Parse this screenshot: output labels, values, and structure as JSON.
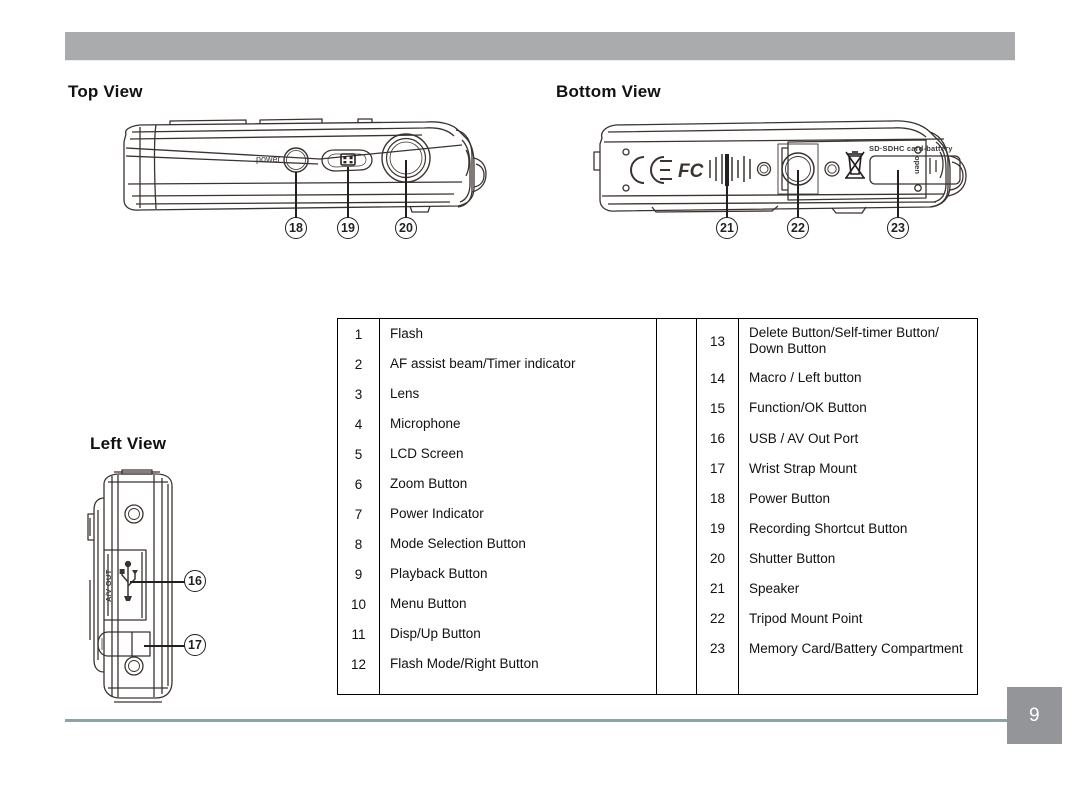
{
  "page": {
    "number": "9",
    "header_color": "#a9abad",
    "footer_rule_color": "#8fa3a4",
    "badge_color": "#939598"
  },
  "views": {
    "top": {
      "title": "Top View",
      "labels": {
        "power": "power"
      },
      "callouts": [
        {
          "id": "18",
          "label": "18"
        },
        {
          "id": "19",
          "label": "19"
        },
        {
          "id": "20",
          "label": "20"
        }
      ]
    },
    "bottom": {
      "title": "Bottom View",
      "labels": {
        "card_battery": "SD·SDHC card-battery",
        "open": "open",
        "ce": "CE",
        "fcc": "FC"
      },
      "callouts": [
        {
          "id": "21",
          "label": "21"
        },
        {
          "id": "22",
          "label": "22"
        },
        {
          "id": "23",
          "label": "23"
        }
      ]
    },
    "left": {
      "title": "Left View",
      "labels": {
        "av_out": "A/V OUT"
      },
      "callouts": [
        {
          "id": "16",
          "label": "16"
        },
        {
          "id": "17",
          "label": "17"
        }
      ]
    }
  },
  "legend": {
    "left_column": [
      {
        "num": "1",
        "text": "Flash"
      },
      {
        "num": "2",
        "text": "AF assist beam/Timer indicator"
      },
      {
        "num": "3",
        "text": "Lens"
      },
      {
        "num": "4",
        "text": "Microphone"
      },
      {
        "num": "5",
        "text": "LCD Screen"
      },
      {
        "num": "6",
        "text": "Zoom Button"
      },
      {
        "num": "7",
        "text": "Power Indicator"
      },
      {
        "num": "8",
        "text": "Mode Selection Button"
      },
      {
        "num": "9",
        "text": "Playback Button"
      },
      {
        "num": "10",
        "text": "Menu Button"
      },
      {
        "num": "11",
        "text": "Disp/Up Button"
      },
      {
        "num": "12",
        "text": "Flash Mode/Right Button"
      }
    ],
    "right_column": [
      {
        "num": "13",
        "text": "Delete Button/Self-timer Button/ Down Button"
      },
      {
        "num": "14",
        "text": "Macro / Left button"
      },
      {
        "num": "15",
        "text": "Function/OK Button"
      },
      {
        "num": "16",
        "text": "USB / AV Out Port"
      },
      {
        "num": "17",
        "text": "Wrist Strap Mount"
      },
      {
        "num": "18",
        "text": "Power Button"
      },
      {
        "num": "19",
        "text": "Recording Shortcut Button"
      },
      {
        "num": "20",
        "text": "Shutter Button"
      },
      {
        "num": "21",
        "text": "Speaker"
      },
      {
        "num": "22",
        "text": "Tripod Mount Point"
      },
      {
        "num": "23",
        "text": "Memory Card/Battery Compartment"
      }
    ]
  }
}
